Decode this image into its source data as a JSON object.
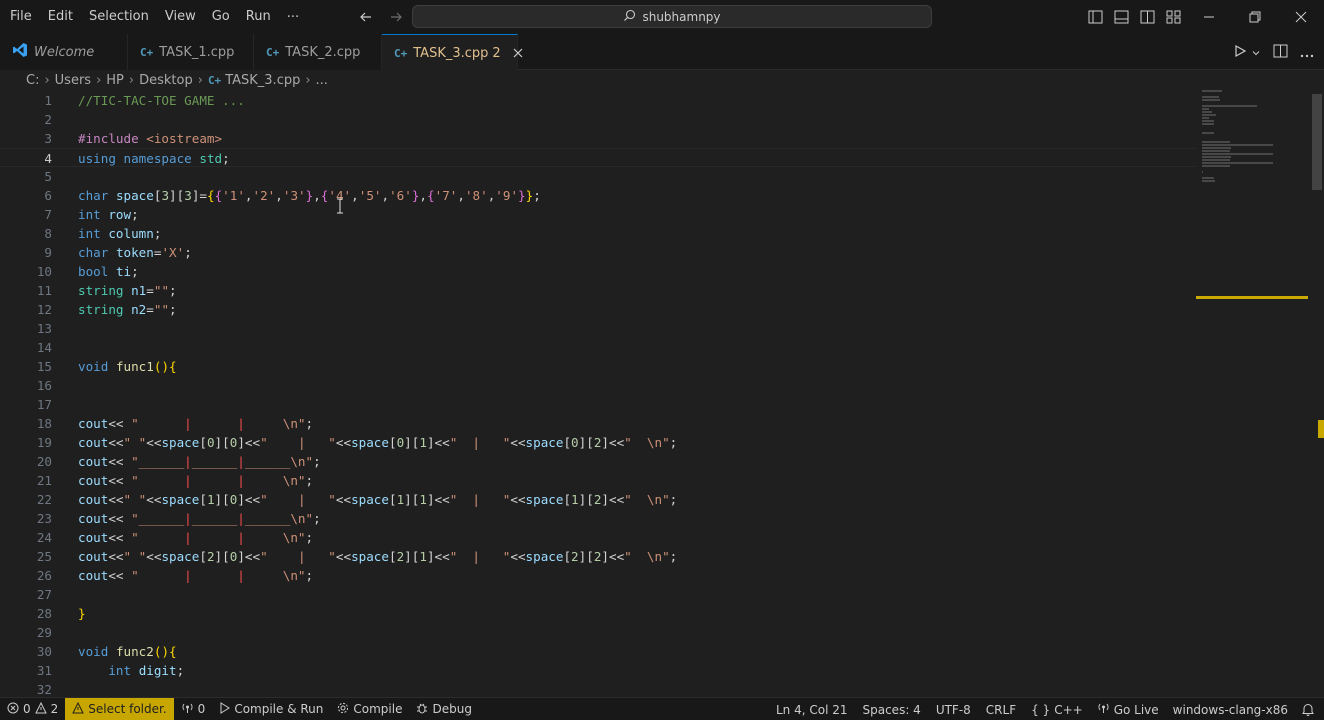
{
  "menu": {
    "items": [
      "File",
      "Edit",
      "Selection",
      "View",
      "Go",
      "Run"
    ],
    "more": "···"
  },
  "command_center": {
    "text": "shubhamnpy",
    "icon": "search-icon"
  },
  "tabs": [
    {
      "label": "Welcome",
      "icon": "vscode-icon",
      "italic": true
    },
    {
      "label": "TASK_1.cpp",
      "icon": "cpp-file-icon"
    },
    {
      "label": "TASK_2.cpp",
      "icon": "cpp-file-icon"
    },
    {
      "label": "TASK_3.cpp",
      "problems": "2",
      "icon": "cpp-file-icon",
      "active": true
    }
  ],
  "breadcrumb": [
    "C:",
    "Users",
    "HP",
    "Desktop",
    "TASK_3.cpp",
    "..."
  ],
  "editor": {
    "current_line": 4,
    "lines": [
      [
        [
          "tk-comment",
          "//TIC-TAC-TOE GAME ..."
        ]
      ],
      [],
      [
        [
          "tk-pp",
          "#include "
        ],
        [
          "tk-str",
          "<iostream>"
        ]
      ],
      [
        [
          "tk-kw",
          "using"
        ],
        [
          "tk-plain",
          " "
        ],
        [
          "tk-kw",
          "namespace"
        ],
        [
          "tk-plain",
          " "
        ],
        [
          "tk-type",
          "std"
        ],
        [
          "tk-plain",
          ";"
        ]
      ],
      [],
      [
        [
          "tk-kw",
          "char"
        ],
        [
          "tk-plain",
          " "
        ],
        [
          "tk-var",
          "space"
        ],
        [
          "tk-plain",
          "["
        ],
        [
          "tk-num",
          "3"
        ],
        [
          "tk-plain",
          "]["
        ],
        [
          "tk-num",
          "3"
        ],
        [
          "tk-plain",
          "]="
        ],
        [
          "tk-brace",
          "{"
        ],
        [
          "tk-brace2",
          "{"
        ],
        [
          "tk-str",
          "'1'"
        ],
        [
          "tk-plain",
          ","
        ],
        [
          "tk-str",
          "'2'"
        ],
        [
          "tk-plain",
          ","
        ],
        [
          "tk-str",
          "'3'"
        ],
        [
          "tk-brace2",
          "}"
        ],
        [
          "tk-plain",
          ","
        ],
        [
          "tk-brace2",
          "{"
        ],
        [
          "tk-str",
          "'4'"
        ],
        [
          "tk-plain",
          ","
        ],
        [
          "tk-str",
          "'5'"
        ],
        [
          "tk-plain",
          ","
        ],
        [
          "tk-str",
          "'6'"
        ],
        [
          "tk-brace2",
          "}"
        ],
        [
          "tk-plain",
          ","
        ],
        [
          "tk-brace2",
          "{"
        ],
        [
          "tk-str",
          "'7'"
        ],
        [
          "tk-plain",
          ","
        ],
        [
          "tk-str",
          "'8'"
        ],
        [
          "tk-plain",
          ","
        ],
        [
          "tk-str",
          "'9'"
        ],
        [
          "tk-brace2",
          "}"
        ],
        [
          "tk-brace",
          "}"
        ],
        [
          "tk-plain",
          ";"
        ]
      ],
      [
        [
          "tk-kw",
          "int"
        ],
        [
          "tk-plain",
          " "
        ],
        [
          "tk-var",
          "row"
        ],
        [
          "tk-plain",
          ";"
        ]
      ],
      [
        [
          "tk-kw",
          "int"
        ],
        [
          "tk-plain",
          " "
        ],
        [
          "tk-var",
          "column"
        ],
        [
          "tk-plain",
          ";"
        ]
      ],
      [
        [
          "tk-kw",
          "char"
        ],
        [
          "tk-plain",
          " "
        ],
        [
          "tk-var",
          "token"
        ],
        [
          "tk-plain",
          "="
        ],
        [
          "tk-str",
          "'X'"
        ],
        [
          "tk-plain",
          ";"
        ]
      ],
      [
        [
          "tk-kw",
          "bool"
        ],
        [
          "tk-plain",
          " "
        ],
        [
          "tk-var",
          "ti"
        ],
        [
          "tk-plain",
          ";"
        ]
      ],
      [
        [
          "tk-type",
          "string"
        ],
        [
          "tk-plain",
          " "
        ],
        [
          "tk-var",
          "n1"
        ],
        [
          "tk-plain",
          "="
        ],
        [
          "tk-str",
          "\"\""
        ],
        [
          "tk-plain",
          ";"
        ]
      ],
      [
        [
          "tk-type",
          "string"
        ],
        [
          "tk-plain",
          " "
        ],
        [
          "tk-var",
          "n2"
        ],
        [
          "tk-plain",
          "="
        ],
        [
          "tk-str",
          "\"\""
        ],
        [
          "tk-plain",
          ";"
        ]
      ],
      [],
      [],
      [
        [
          "tk-kw",
          "void"
        ],
        [
          "tk-plain",
          " "
        ],
        [
          "tk-fn",
          "func1"
        ],
        [
          "tk-brace",
          "()"
        ],
        [
          "tk-brace",
          "{"
        ]
      ],
      [],
      [],
      [
        [
          "tk-var",
          "cout"
        ],
        [
          "tk-plain",
          "<< "
        ],
        [
          "tk-str",
          "\"      "
        ],
        [
          "tk-pipe",
          "|"
        ],
        [
          "tk-str",
          "      "
        ],
        [
          "tk-pipe",
          "|"
        ],
        [
          "tk-str",
          "     \\n\""
        ],
        [
          "tk-plain",
          ";"
        ]
      ],
      [
        [
          "tk-var",
          "cout"
        ],
        [
          "tk-plain",
          "<<"
        ],
        [
          "tk-str",
          "\" \""
        ],
        [
          "tk-plain",
          "<<"
        ],
        [
          "tk-var",
          "space"
        ],
        [
          "tk-plain",
          "["
        ],
        [
          "tk-num",
          "0"
        ],
        [
          "tk-plain",
          "]["
        ],
        [
          "tk-num",
          "0"
        ],
        [
          "tk-plain",
          "]<<"
        ],
        [
          "tk-str",
          "\"    |   \""
        ],
        [
          "tk-plain",
          "<<"
        ],
        [
          "tk-var",
          "space"
        ],
        [
          "tk-plain",
          "["
        ],
        [
          "tk-num",
          "0"
        ],
        [
          "tk-plain",
          "]["
        ],
        [
          "tk-num",
          "1"
        ],
        [
          "tk-plain",
          "]<<"
        ],
        [
          "tk-str",
          "\"  |   \""
        ],
        [
          "tk-plain",
          "<<"
        ],
        [
          "tk-var",
          "space"
        ],
        [
          "tk-plain",
          "["
        ],
        [
          "tk-num",
          "0"
        ],
        [
          "tk-plain",
          "]["
        ],
        [
          "tk-num",
          "2"
        ],
        [
          "tk-plain",
          "]<<"
        ],
        [
          "tk-str",
          "\"  \\n\""
        ],
        [
          "tk-plain",
          ";"
        ]
      ],
      [
        [
          "tk-var",
          "cout"
        ],
        [
          "tk-plain",
          "<< "
        ],
        [
          "tk-str",
          "\"______"
        ],
        [
          "tk-pipe",
          "|"
        ],
        [
          "tk-str",
          "______"
        ],
        [
          "tk-pipe",
          "|"
        ],
        [
          "tk-str",
          "______\\n\""
        ],
        [
          "tk-plain",
          ";"
        ]
      ],
      [
        [
          "tk-var",
          "cout"
        ],
        [
          "tk-plain",
          "<< "
        ],
        [
          "tk-str",
          "\"      "
        ],
        [
          "tk-pipe",
          "|"
        ],
        [
          "tk-str",
          "      "
        ],
        [
          "tk-pipe",
          "|"
        ],
        [
          "tk-str",
          "     \\n\""
        ],
        [
          "tk-plain",
          ";"
        ]
      ],
      [
        [
          "tk-var",
          "cout"
        ],
        [
          "tk-plain",
          "<<"
        ],
        [
          "tk-str",
          "\" \""
        ],
        [
          "tk-plain",
          "<<"
        ],
        [
          "tk-var",
          "space"
        ],
        [
          "tk-plain",
          "["
        ],
        [
          "tk-num",
          "1"
        ],
        [
          "tk-plain",
          "]["
        ],
        [
          "tk-num",
          "0"
        ],
        [
          "tk-plain",
          "]<<"
        ],
        [
          "tk-str",
          "\"    |   \""
        ],
        [
          "tk-plain",
          "<<"
        ],
        [
          "tk-var",
          "space"
        ],
        [
          "tk-plain",
          "["
        ],
        [
          "tk-num",
          "1"
        ],
        [
          "tk-plain",
          "]["
        ],
        [
          "tk-num",
          "1"
        ],
        [
          "tk-plain",
          "]<<"
        ],
        [
          "tk-str",
          "\"  |   \""
        ],
        [
          "tk-plain",
          "<<"
        ],
        [
          "tk-var",
          "space"
        ],
        [
          "tk-plain",
          "["
        ],
        [
          "tk-num",
          "1"
        ],
        [
          "tk-plain",
          "]["
        ],
        [
          "tk-num",
          "2"
        ],
        [
          "tk-plain",
          "]<<"
        ],
        [
          "tk-str",
          "\"  \\n\""
        ],
        [
          "tk-plain",
          ";"
        ]
      ],
      [
        [
          "tk-var",
          "cout"
        ],
        [
          "tk-plain",
          "<< "
        ],
        [
          "tk-str",
          "\"______"
        ],
        [
          "tk-pipe",
          "|"
        ],
        [
          "tk-str",
          "______"
        ],
        [
          "tk-pipe",
          "|"
        ],
        [
          "tk-str",
          "______\\n\""
        ],
        [
          "tk-plain",
          ";"
        ]
      ],
      [
        [
          "tk-var",
          "cout"
        ],
        [
          "tk-plain",
          "<< "
        ],
        [
          "tk-str",
          "\"      "
        ],
        [
          "tk-pipe",
          "|"
        ],
        [
          "tk-str",
          "      "
        ],
        [
          "tk-pipe",
          "|"
        ],
        [
          "tk-str",
          "     \\n\""
        ],
        [
          "tk-plain",
          ";"
        ]
      ],
      [
        [
          "tk-var",
          "cout"
        ],
        [
          "tk-plain",
          "<<"
        ],
        [
          "tk-str",
          "\" \""
        ],
        [
          "tk-plain",
          "<<"
        ],
        [
          "tk-var",
          "space"
        ],
        [
          "tk-plain",
          "["
        ],
        [
          "tk-num",
          "2"
        ],
        [
          "tk-plain",
          "]["
        ],
        [
          "tk-num",
          "0"
        ],
        [
          "tk-plain",
          "]<<"
        ],
        [
          "tk-str",
          "\"    |   \""
        ],
        [
          "tk-plain",
          "<<"
        ],
        [
          "tk-var",
          "space"
        ],
        [
          "tk-plain",
          "["
        ],
        [
          "tk-num",
          "2"
        ],
        [
          "tk-plain",
          "]["
        ],
        [
          "tk-num",
          "1"
        ],
        [
          "tk-plain",
          "]<<"
        ],
        [
          "tk-str",
          "\"  |   \""
        ],
        [
          "tk-plain",
          "<<"
        ],
        [
          "tk-var",
          "space"
        ],
        [
          "tk-plain",
          "["
        ],
        [
          "tk-num",
          "2"
        ],
        [
          "tk-plain",
          "]["
        ],
        [
          "tk-num",
          "2"
        ],
        [
          "tk-plain",
          "]<<"
        ],
        [
          "tk-str",
          "\"  \\n\""
        ],
        [
          "tk-plain",
          ";"
        ]
      ],
      [
        [
          "tk-var",
          "cout"
        ],
        [
          "tk-plain",
          "<< "
        ],
        [
          "tk-str",
          "\"      "
        ],
        [
          "tk-pipe",
          "|"
        ],
        [
          "tk-str",
          "      "
        ],
        [
          "tk-pipe",
          "|"
        ],
        [
          "tk-str",
          "     \\n\""
        ],
        [
          "tk-plain",
          ";"
        ]
      ],
      [],
      [
        [
          "tk-brace",
          "}"
        ]
      ],
      [],
      [
        [
          "tk-kw",
          "void"
        ],
        [
          "tk-plain",
          " "
        ],
        [
          "tk-fn",
          "func2"
        ],
        [
          "tk-brace",
          "()"
        ],
        [
          "tk-brace",
          "{"
        ]
      ],
      [
        [
          "tk-plain",
          "    "
        ],
        [
          "tk-kw",
          "int"
        ],
        [
          "tk-plain",
          " "
        ],
        [
          "tk-var",
          "digit"
        ],
        [
          "tk-plain",
          ";"
        ]
      ],
      []
    ]
  },
  "statusbar": {
    "errors": "0",
    "warnings": "2",
    "select_folder": "Select folder.",
    "ports": "0",
    "compile_run": "Compile & Run",
    "compile": "Compile",
    "debug": "Debug",
    "position": "Ln 4, Col 21",
    "spaces": "Spaces: 4",
    "encoding": "UTF-8",
    "eol": "CRLF",
    "language": "C++",
    "language_braces": "{ }",
    "go_live": "Go Live",
    "compiler": "windows-clang-x86"
  },
  "colors": {
    "accent": "#0078d4",
    "warning": "#c7a600",
    "active_tab_text": "#e2c08d"
  }
}
